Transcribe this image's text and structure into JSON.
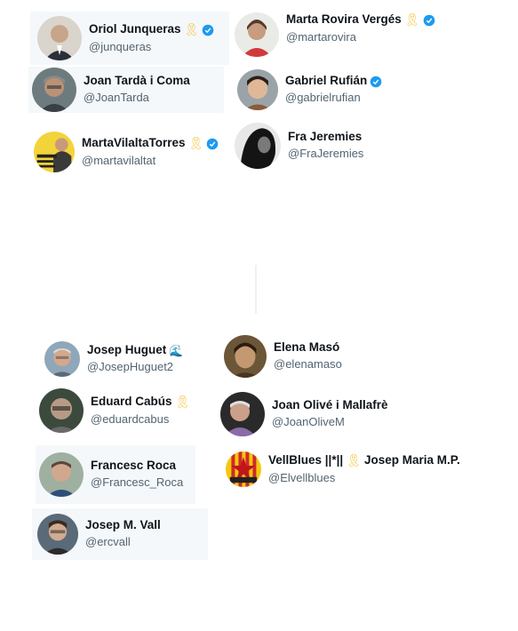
{
  "colors": {
    "verified": "#1d9bf0",
    "ribbon": "#f4c542",
    "handle": "#536471",
    "name": "#0f1419"
  },
  "accounts": [
    {
      "name": "Oriol Junqueras",
      "handle": "@junqueras",
      "ribbon": "🎗",
      "verified": true
    },
    {
      "name": "Marta Rovira Vergés",
      "handle": "@martarovira",
      "ribbon": "🎗",
      "verified": true
    },
    {
      "name": "Joan Tardà i Coma",
      "handle": "@JoanTarda",
      "ribbon": "",
      "verified": false
    },
    {
      "name": "Gabriel Rufián",
      "handle": "@gabrielrufian",
      "ribbon": "",
      "verified": true
    },
    {
      "name": "MartaVilaltaTorres",
      "handle": "@martavilaltat",
      "ribbon": "🎗",
      "verified": true
    },
    {
      "name": "Fra Jeremies",
      "handle": "@FraJeremies",
      "ribbon": "",
      "verified": false
    },
    {
      "name": "Josep Huguet",
      "handle": "@JosepHuguet2",
      "emoji": "🌊",
      "verified": false
    },
    {
      "name": "Elena Masó",
      "handle": "@elenamaso",
      "verified": false
    },
    {
      "name": "Eduard Cabús",
      "handle": "@eduardcabus",
      "ribbon": "🎗",
      "verified": false
    },
    {
      "name": "Joan Olivé i Mallafrè",
      "handle": "@JoanOliveM",
      "verified": false
    },
    {
      "name": "Francesc Roca",
      "handle": "@Francesc_Roca",
      "verified": false
    },
    {
      "name": "VellBlues ||*||",
      "name_suffix": "Josep Maria M.P.",
      "handle": "@Elvellblues",
      "ribbon": "🎗",
      "verified": false
    },
    {
      "name": "Josep M. Vall",
      "handle": "@ercvall",
      "verified": false
    }
  ]
}
